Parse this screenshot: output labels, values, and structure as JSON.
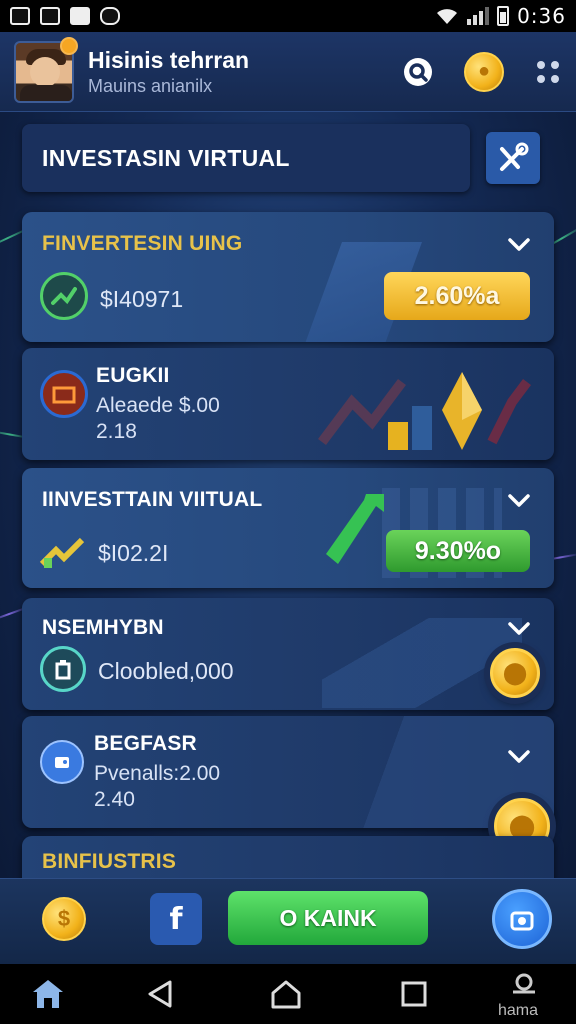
{
  "status_bar": {
    "time": "0:36"
  },
  "header": {
    "name": "Hisinis tehrran",
    "subtitle": "Mauins anianilx",
    "icons": [
      "search-icon",
      "coin-icon",
      "menu-dots-icon"
    ]
  },
  "panel": {
    "title": "INVESTASIN VIRTUAL"
  },
  "cards": [
    {
      "title": "FINVERTESIN UING",
      "value": "$I40971",
      "badge": "2.60%a"
    },
    {
      "title": "EUGKII",
      "line1": "Aleaede $.00",
      "line2": "2.18"
    },
    {
      "title": "IINVESTTAIN VIITUAL",
      "value": "$I02.2I",
      "badge": "9.30%o"
    },
    {
      "title": "NSEMHYBN",
      "value": "Cloobled,000"
    },
    {
      "title": "BEGFASR",
      "line1": "Pvenalls:2.00",
      "line2": "2.40"
    },
    {
      "title": "BINFIUSTRIS"
    }
  ],
  "action_bar": {
    "main_button": "O KAINK",
    "fb_label": "f"
  },
  "nav": {
    "label": "hama"
  },
  "colors": {
    "gold": "#e7c24a",
    "green": "#2f9a2e",
    "accent": "#2a5aa8"
  }
}
